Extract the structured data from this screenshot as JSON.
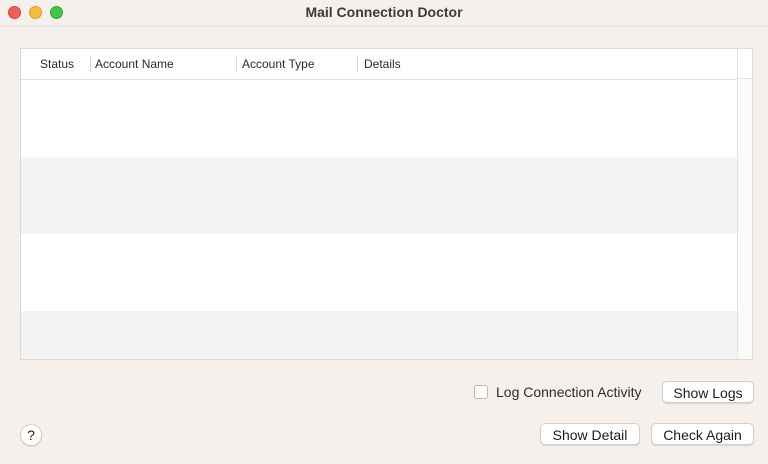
{
  "window": {
    "title": "Mail Connection Doctor"
  },
  "table": {
    "columns": [
      {
        "label": "Status"
      },
      {
        "label": "Account Name"
      },
      {
        "label": "Account Type"
      },
      {
        "label": "Details"
      }
    ],
    "rows": []
  },
  "controls": {
    "log_connection_label": "Log Connection Activity",
    "log_connection_checked": false,
    "show_logs_label": "Show Logs",
    "show_detail_label": "Show Detail",
    "check_again_label": "Check Again",
    "help_label": "?"
  },
  "colors": {
    "close": "#ee5f58",
    "minimize": "#f6bd3b",
    "maximize": "#42c541"
  }
}
